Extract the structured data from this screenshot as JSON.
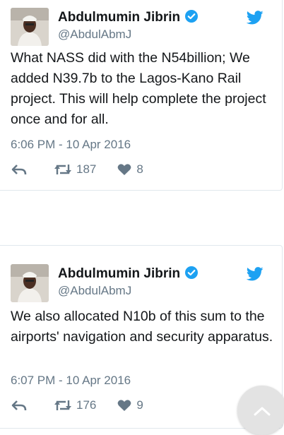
{
  "colors": {
    "verified": "#1da1f2",
    "bird": "#1da1f2",
    "text": "#14171a",
    "secondary": "#657786"
  },
  "tweets": [
    {
      "name": "Abdulmumin Jibrin",
      "handle": "@AbdulAbmJ",
      "text": "What NASS did with the N54billion; We added N39.7b to the Lagos-Kano Rail project. This will help complete the project once and for all.",
      "time": "6:06 PM - 10 Apr 2016",
      "retweets": "187",
      "likes": "8"
    },
    {
      "name": "Abdulmumin Jibrin",
      "handle": "@AbdulAbmJ",
      "text": "We also allocated N10b of this sum to the airports' navigation and security apparatus.",
      "time": "6:07 PM - 10 Apr 2016",
      "retweets": "176",
      "likes": "9"
    }
  ],
  "icons": {
    "verified": "verified-badge-icon",
    "bird": "twitter-bird-icon",
    "reply": "reply-icon",
    "retweet": "retweet-icon",
    "like": "heart-icon",
    "scroll_top": "chevron-up-icon"
  }
}
